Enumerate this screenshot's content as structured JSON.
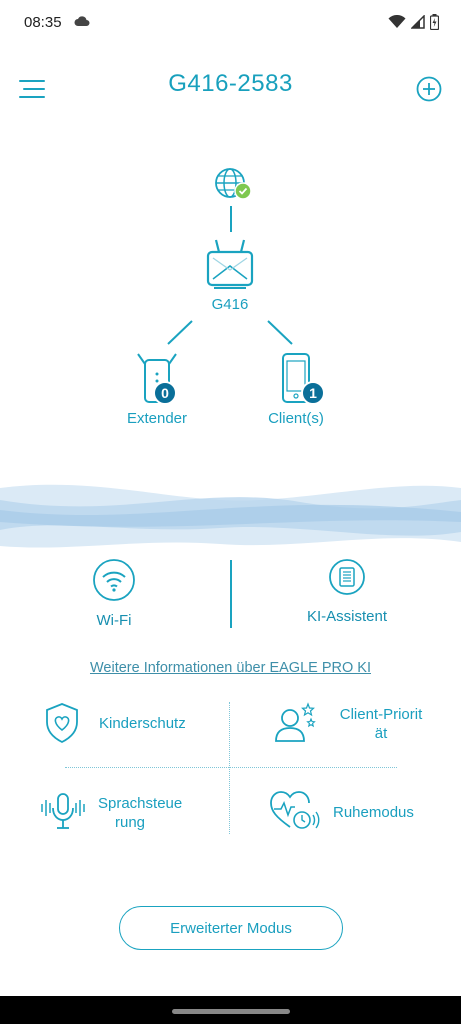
{
  "status_bar": {
    "time": "08:35"
  },
  "header": {
    "title": "G416-2583"
  },
  "topology": {
    "internet_icon": "globe-icon",
    "router_label": "G416",
    "extender_label": "Extender",
    "extender_count": "0",
    "clients_label": "Client(s)",
    "clients_count": "1"
  },
  "features": {
    "wifi_label": "Wi-Fi",
    "ai_assistant_label": "KI-Assistent"
  },
  "info_link": "Weitere Informationen über EAGLE PRO KI",
  "tools": {
    "parental_control": "Kinderschutz",
    "client_priority_line1": "Client-Priorit",
    "client_priority_line2": "ät",
    "voice_control_line1": "Sprachsteue",
    "voice_control_line2": "rung",
    "sleep_mode": "Ruhemodus"
  },
  "advanced_mode_button": "Erweiterter Modus",
  "colors": {
    "accent": "#1aa3c0",
    "badge": "#0a6f99",
    "check": "#7ec850"
  }
}
